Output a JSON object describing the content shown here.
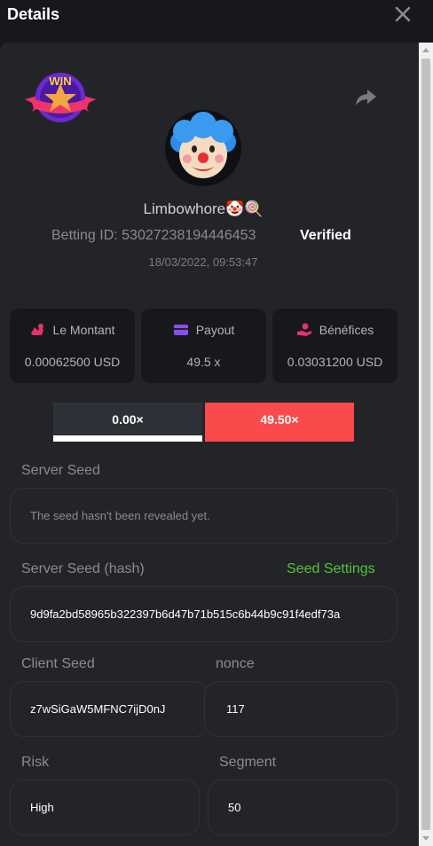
{
  "header": {
    "title": "Details",
    "close_icon": "close-icon"
  },
  "profile": {
    "badge_text": "WIN",
    "username": "Limbowhore🤡🍭",
    "betting_id": "Betting ID: 53027238194446453",
    "verified": "Verified",
    "date": "18/03/2022, 09:53:47"
  },
  "stats": [
    {
      "label": "Le Montant",
      "value": "0.00062500 USD",
      "icon": "money-bag-icon",
      "icon_color": "#e8316d"
    },
    {
      "label": "Payout",
      "value": "49.5 x",
      "icon": "wallet-icon",
      "icon_color": "#8a4df0"
    },
    {
      "label": "Bénéfices",
      "value": "0.03031200 USD",
      "icon": "profit-hand-icon",
      "icon_color": "#e8316d"
    }
  ],
  "tabs": [
    {
      "label": "0.00×",
      "color": "#2f3138"
    },
    {
      "label": "49.50×",
      "color": "#fa4a4c"
    }
  ],
  "server_seed": {
    "label": "Server Seed",
    "value": "The seed hasn't been revealed yet."
  },
  "server_seed_hash": {
    "label": "Server Seed (hash)",
    "link": "Seed Settings",
    "value": "9d9fa2bd58965b322397b6d47b71b515c6b44b9c91f4edf73a"
  },
  "client_seed": {
    "label": "Client Seed",
    "value": "z7wSiGaW5MFNC7ijD0nJ"
  },
  "nonce": {
    "label": "nonce",
    "value": "117"
  },
  "risk": {
    "label": "Risk",
    "value": "High"
  },
  "segment": {
    "label": "Segment",
    "value": "50"
  },
  "colors": {
    "accent_red": "#fa4a4c",
    "link_green": "#55c23b",
    "panel": "#232428",
    "background": "#17181b"
  }
}
